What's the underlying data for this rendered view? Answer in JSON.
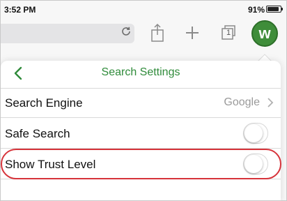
{
  "status_bar": {
    "time": "3:52 PM",
    "battery_percent": "91%",
    "battery_level": 0.91
  },
  "toolbar": {
    "reload_icon": "reload-icon",
    "share_icon": "share-icon",
    "add_icon": "plus-icon",
    "tabs_count": "1",
    "avatar_letter": "w"
  },
  "panel": {
    "title": "Search Settings",
    "back_icon": "chevron-left-icon",
    "accent_color": "#2f8b3a",
    "rows": [
      {
        "label": "Search Engine",
        "value": "Google",
        "type": "disclosure"
      },
      {
        "label": "Safe Search",
        "type": "toggle",
        "on": false
      },
      {
        "label": "Show Trust Level",
        "type": "toggle",
        "on": false,
        "highlighted": true
      }
    ]
  },
  "highlight_color": "#d6333a"
}
